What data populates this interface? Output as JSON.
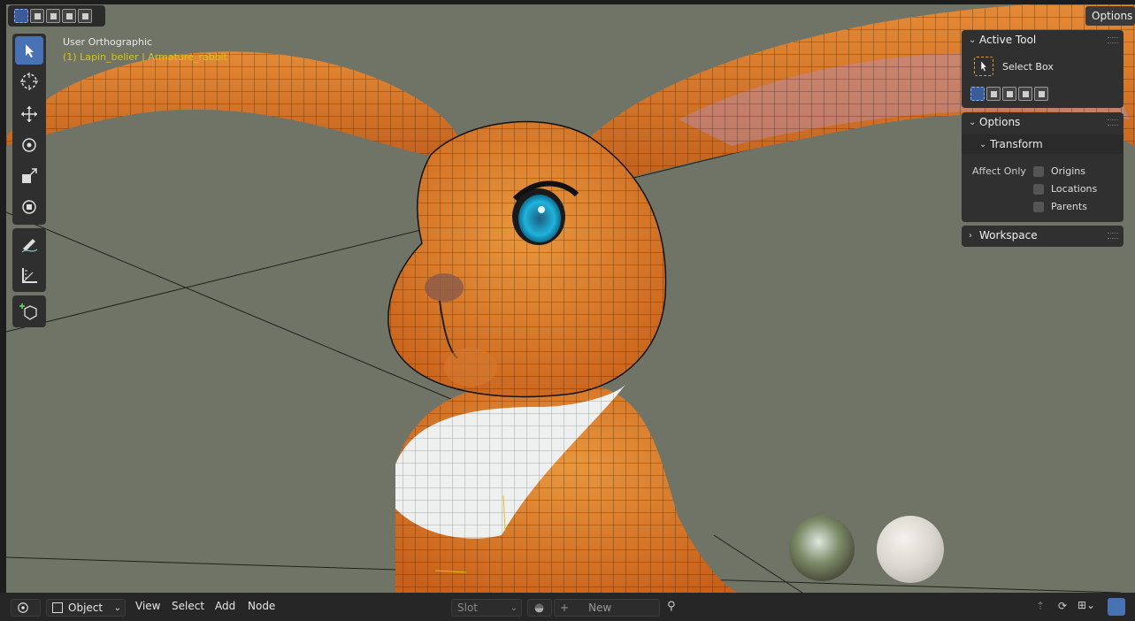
{
  "viewport": {
    "view_name": "User Orthographic",
    "object_info": "(1) Lapin_belier | Armature_rabbit"
  },
  "header": {
    "options_label": "Options"
  },
  "toolbar": {
    "tools": [
      "select-box",
      "cursor",
      "move",
      "rotate",
      "scale",
      "transform",
      "annotate",
      "measure",
      "add-cube"
    ],
    "active_tool": "select-box"
  },
  "sidebar": {
    "active_tool_panel": {
      "title": "Active Tool",
      "tool_name": "Select Box"
    },
    "options_panel": {
      "title": "Options",
      "transform_label": "Transform",
      "affect_only_label": "Affect Only",
      "checkboxes": [
        {
          "label": "Origins",
          "checked": false
        },
        {
          "label": "Locations",
          "checked": false
        },
        {
          "label": "Parents",
          "checked": false
        }
      ]
    },
    "workspace_panel": {
      "title": "Workspace"
    }
  },
  "statusbar": {
    "mode": "Object",
    "menus": [
      "View",
      "Select",
      "Add",
      "Node"
    ],
    "slot_label": "Slot",
    "new_label": "New"
  },
  "colors": {
    "accent": "#4772b3",
    "object_info_text": "#d8c21a",
    "viewport_bg": "#6f7467"
  }
}
